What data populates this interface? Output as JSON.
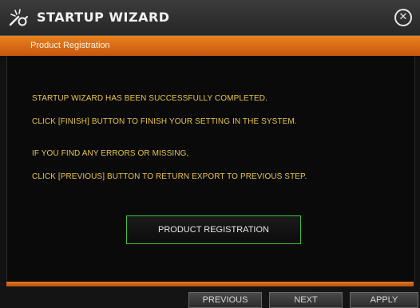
{
  "window": {
    "title": "STARTUP WIZARD",
    "icon": "wizard-tools-icon",
    "close_icon": "close-icon"
  },
  "section": {
    "title": "Product Registration"
  },
  "messages": [
    "STARTUP WIZARD HAS BEEN SUCCESSFULLY COMPLETED.",
    "CLICK [FINISH] BUTTON TO FINISH YOUR SETTING IN THE SYSTEM.",
    "IF YOU FIND ANY ERRORS OR MISSING,",
    "CLICK [PREVIOUS] BUTTON TO RETURN EXPORT TO PREVIOUS STEP."
  ],
  "buttons": {
    "product_registration": "PRODUCT REGISTRATION",
    "previous": "PREVIOUS",
    "next": "NEXT",
    "apply": "APPLY"
  },
  "colors": {
    "accent": "#d9691a",
    "message_text": "#e8c548",
    "button_border": "#3fbf3f"
  }
}
